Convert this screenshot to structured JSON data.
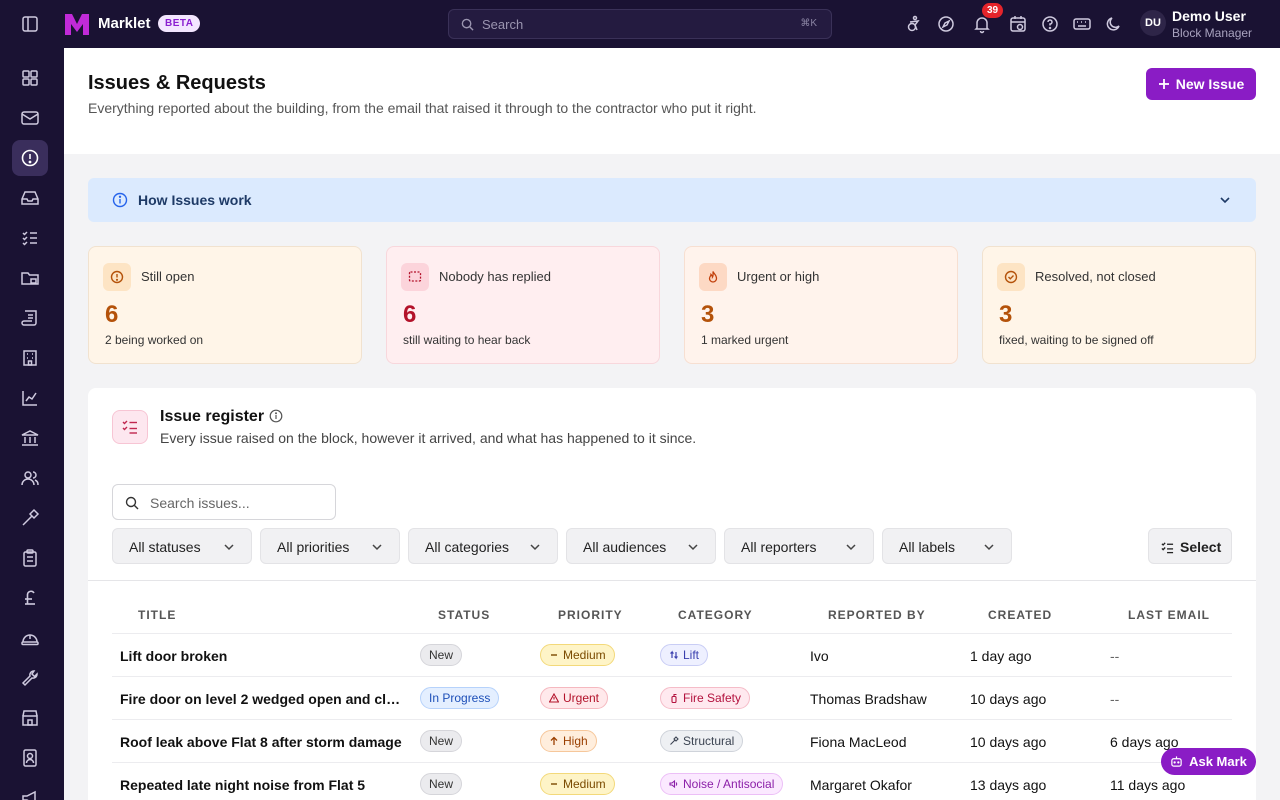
{
  "app": {
    "brand": "Marklet",
    "beta": "BETA"
  },
  "search": {
    "placeholder": "Search",
    "shortcut": "⌘K"
  },
  "notifications": {
    "count": "39"
  },
  "user": {
    "initials": "DU",
    "name": "Demo User",
    "role": "Block Manager"
  },
  "page": {
    "title": "Issues & Requests",
    "subtitle": "Everything reported about the building, from the email that raised it through to the contractor who put it right.",
    "new_issue_label": "New Issue"
  },
  "info_banner": {
    "label": "How Issues work"
  },
  "stats": [
    {
      "label": "Still open",
      "value": "6",
      "sub": "2 being worked on",
      "accent": "#b4520a"
    },
    {
      "label": "Nobody has replied",
      "value": "6",
      "sub": "still waiting to hear back",
      "accent": "#b3122a"
    },
    {
      "label": "Urgent or high",
      "value": "3",
      "sub": "1 marked urgent",
      "accent": "#b4520a"
    },
    {
      "label": "Resolved, not closed",
      "value": "3",
      "sub": "fixed, waiting to be signed off",
      "accent": "#b4520a"
    }
  ],
  "register": {
    "title": "Issue register",
    "subtitle": "Every issue raised on the block, however it arrived, and what has happened to it since.",
    "search_placeholder": "Search issues...",
    "filters": [
      "All statuses",
      "All priorities",
      "All categories",
      "All audiences",
      "All reporters",
      "All labels"
    ],
    "select_label": "Select",
    "columns": [
      "TITLE",
      "STATUS",
      "PRIORITY",
      "CATEGORY",
      "REPORTED BY",
      "CREATED",
      "LAST EMAIL"
    ],
    "rows": [
      {
        "title": "Lift door broken",
        "status": "New",
        "priority": "Medium",
        "category": "Lift",
        "reporter": "Ivo",
        "created": "1 day ago",
        "last_email": "--"
      },
      {
        "title": "Fire door on level 2 wedged open and clo...",
        "status": "In Progress",
        "priority": "Urgent",
        "category": "Fire Safety",
        "reporter": "Thomas Bradshaw",
        "created": "10 days ago",
        "last_email": "--"
      },
      {
        "title": "Roof leak above Flat 8 after storm damage",
        "status": "New",
        "priority": "High",
        "category": "Structural",
        "reporter": "Fiona MacLeod",
        "created": "10 days ago",
        "last_email": "6 days ago"
      },
      {
        "title": "Repeated late night noise from Flat 5",
        "status": "New",
        "priority": "Medium",
        "category": "Noise / Antisocial",
        "reporter": "Margaret Okafor",
        "created": "13 days ago",
        "last_email": "11 days ago"
      }
    ]
  },
  "assistant": {
    "label": "Ask Mark"
  }
}
